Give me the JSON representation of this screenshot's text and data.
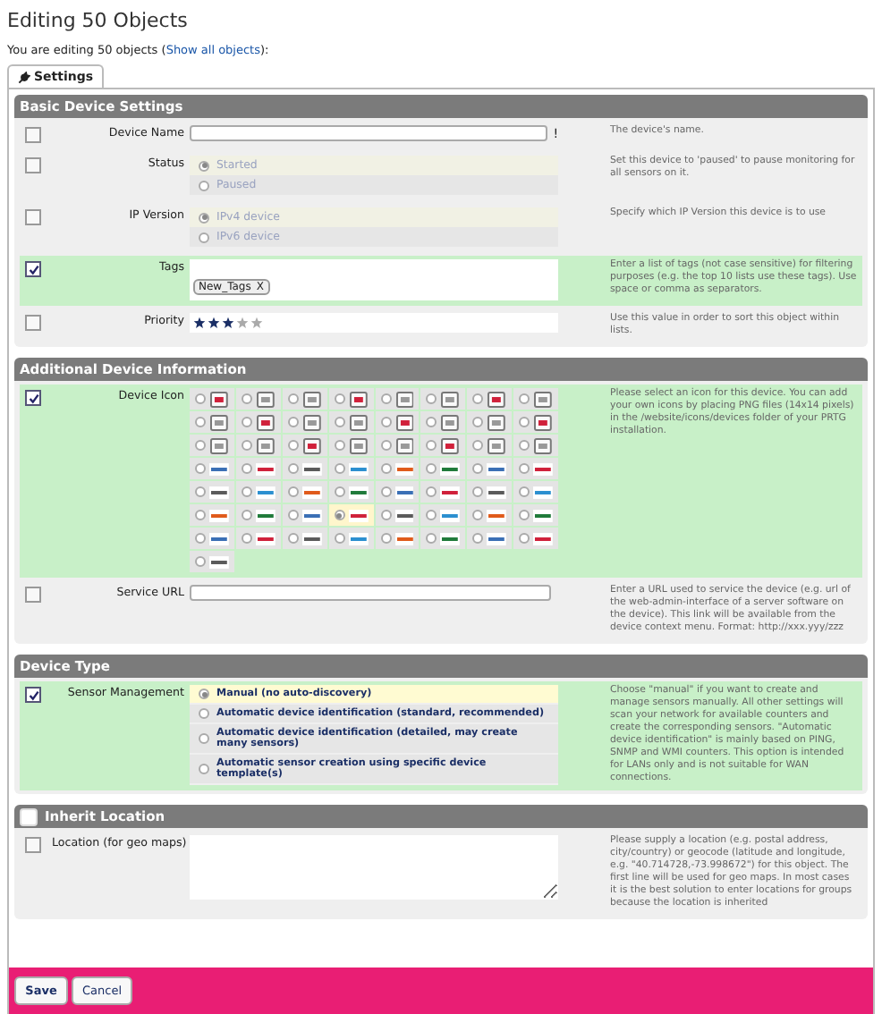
{
  "title": "Editing 50 Objects",
  "intro": {
    "text": "You are editing 50 objects (",
    "link": "Show all objects",
    "end": "):"
  },
  "tabs": [
    {
      "label": "Settings",
      "selected": true
    }
  ],
  "sections": [
    {
      "title": "Basic Device Settings",
      "rows": [
        {
          "kind": "text",
          "checked": false,
          "label": "Device Name",
          "required_mark": "!",
          "description": "The device's name."
        },
        {
          "kind": "radio",
          "checked": false,
          "label": "Status",
          "description": "Set this device to 'paused' to pause monitoring for all sensors on it.",
          "options": [
            {
              "label": "Started",
              "selected": true
            },
            {
              "label": "Paused",
              "selected": false
            }
          ]
        },
        {
          "kind": "radio",
          "checked": false,
          "label": "IP Version",
          "description": "Specify which IP Version this device is to use",
          "options": [
            {
              "label": "IPv4 device",
              "selected": true
            },
            {
              "label": "IPv6 device",
              "selected": false
            }
          ]
        },
        {
          "kind": "tags",
          "checked": true,
          "label": "Tags",
          "description": "Enter a list of tags (not case sensitive) for filtering purposes (e.g. the top 10 lists use these tags). Use space or comma as separators.",
          "tags": [
            {
              "label": "New_Tags",
              "remove": "X"
            }
          ]
        },
        {
          "kind": "stars",
          "checked": false,
          "label": "Priority",
          "stars": 3,
          "description": "Use this value in order to sort this object within lists."
        }
      ]
    },
    {
      "title": "Additional Device Information",
      "rows": [
        {
          "kind": "icons",
          "checked": true,
          "label": "Device Icon",
          "description": "Please select an icon for this device. You can add your own icons by placing PNG files (14x14 pixels) in the /website/icons/devices folder of your PRTG installation.",
          "icons": [
            {
              "selected": false
            },
            {
              "selected": false
            },
            {
              "selected": false
            },
            {
              "selected": false
            },
            {
              "selected": false
            },
            {
              "selected": false
            },
            {
              "selected": false
            },
            {
              "selected": false
            },
            {
              "selected": false
            },
            {
              "selected": false
            },
            {
              "selected": false
            },
            {
              "selected": false
            },
            {
              "selected": false
            },
            {
              "selected": false
            },
            {
              "selected": false
            },
            {
              "selected": false
            },
            {
              "selected": false
            },
            {
              "selected": false
            },
            {
              "selected": false
            },
            {
              "selected": false
            },
            {
              "selected": false
            },
            {
              "selected": false
            },
            {
              "selected": false
            },
            {
              "selected": false
            },
            {
              "selected": false
            },
            {
              "selected": false
            },
            {
              "selected": false
            },
            {
              "selected": false
            },
            {
              "selected": false
            },
            {
              "selected": false
            },
            {
              "selected": false
            },
            {
              "selected": false
            },
            {
              "selected": false
            },
            {
              "selected": false
            },
            {
              "selected": false
            },
            {
              "selected": false
            },
            {
              "selected": false
            },
            {
              "selected": false
            },
            {
              "selected": false
            },
            {
              "selected": false
            },
            {
              "selected": false
            },
            {
              "selected": false
            },
            {
              "selected": false
            },
            {
              "selected": true
            },
            {
              "selected": false
            },
            {
              "selected": false
            },
            {
              "selected": false
            },
            {
              "selected": false
            },
            {
              "selected": false
            },
            {
              "selected": false
            },
            {
              "selected": false
            },
            {
              "selected": false
            },
            {
              "selected": false
            },
            {
              "selected": false
            },
            {
              "selected": false
            },
            {
              "selected": false
            },
            {
              "selected": false
            }
          ]
        },
        {
          "kind": "text",
          "checked": false,
          "label": "Service URL",
          "description": "Enter a URL used to service the device (e.g. url of the web-admin-interface of a server software on the device). This link will be available from the device context menu. Format: http://xxx.yyy/zzz"
        }
      ]
    },
    {
      "title": "Device Type",
      "rows": [
        {
          "kind": "options",
          "checked": true,
          "label": "Sensor Management",
          "description": "Choose \"manual\" if you want to create and manage sensors manually. All other settings will scan your network for available counters and create the corresponding sensors. \"Automatic device identification\" is mainly based on PING, SNMP and WMI counters. This option is intended for LANs only and is not suitable for WAN connections.",
          "options": [
            {
              "label": "Manual (no auto-discovery)",
              "selected": true
            },
            {
              "label": "Automatic device identification (standard, recommended)",
              "selected": false
            },
            {
              "label": "Automatic device identification (detailed, may create many sensors)",
              "selected": false
            },
            {
              "label": "Automatic sensor creation using specific device template(s)",
              "selected": false
            }
          ]
        }
      ]
    },
    {
      "title": "Inherit Location",
      "header_checkbox": {
        "checked": false
      },
      "rows": [
        {
          "kind": "textarea",
          "checked": false,
          "label": "Location (for geo maps)",
          "description": "Please supply a location (e.g. postal address, city/country) or geocode (latitude and longitude, e.g. \"40.714728,-73.998672\") for this object. The first line will be used for geo maps. In most cases it is the best solution to enter locations for groups because the location is inherited"
        }
      ]
    }
  ],
  "buttons": [
    "Save",
    "Cancel"
  ]
}
